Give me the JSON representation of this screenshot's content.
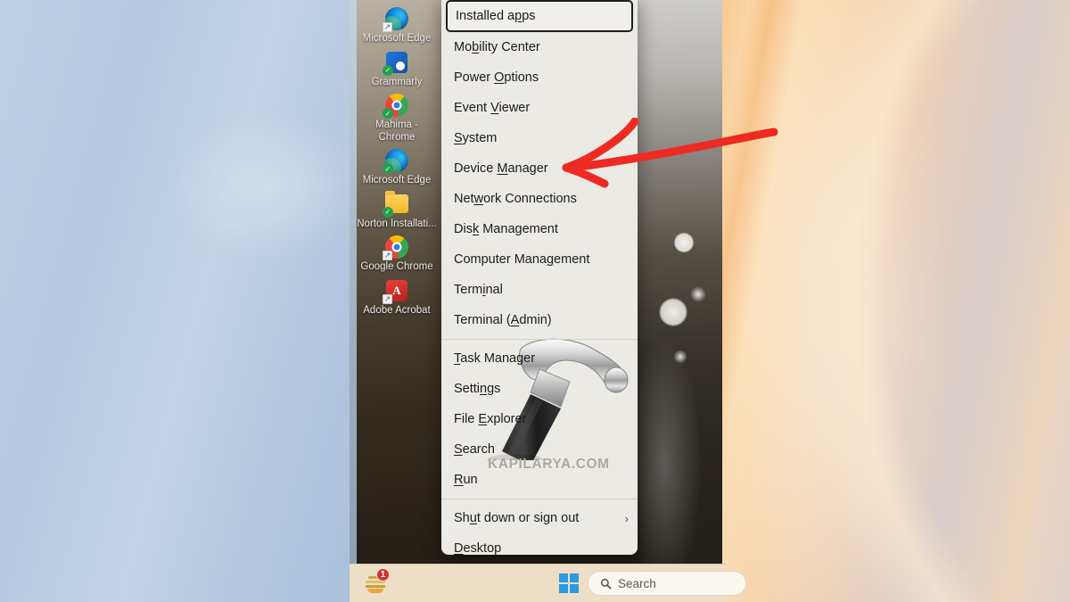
{
  "desktop": {
    "icons": [
      {
        "label": "Microsoft Edge",
        "icon": "edge-icon"
      },
      {
        "label": "Grammarly",
        "icon": "grammarly-icon"
      },
      {
        "label": "Mahima - Chrome",
        "icon": "chrome-icon"
      },
      {
        "label": "Microsoft Edge",
        "icon": "edge-icon"
      },
      {
        "label": "Norton Installati...",
        "icon": "folder-icon"
      },
      {
        "label": "Google Chrome",
        "icon": "chrome-icon"
      },
      {
        "label": "Adobe Acrobat",
        "icon": "acrobat-icon"
      }
    ]
  },
  "winx_menu": {
    "groups": [
      {
        "items": [
          {
            "pre": "Installed a",
            "key": "p",
            "post": "ps",
            "focused": true
          },
          {
            "pre": "Mo",
            "key": "b",
            "post": "ility Center",
            "focused": false
          },
          {
            "pre": "Power ",
            "key": "O",
            "post": "ptions",
            "focused": false
          },
          {
            "pre": "Event ",
            "key": "V",
            "post": "iewer",
            "focused": false
          },
          {
            "pre": "",
            "key": "S",
            "post": "ystem",
            "focused": false
          },
          {
            "pre": "Device ",
            "key": "M",
            "post": "anager",
            "focused": false
          },
          {
            "pre": "Net",
            "key": "w",
            "post": "ork Connections",
            "focused": false
          },
          {
            "pre": "Dis",
            "key": "k",
            "post": " Management",
            "focused": false
          },
          {
            "pre": "Computer Mana",
            "key": "g",
            "post": "ement",
            "focused": false
          },
          {
            "pre": "Term",
            "key": "i",
            "post": "nal",
            "focused": false
          },
          {
            "pre": "Terminal (",
            "key": "A",
            "post": "dmin)",
            "focused": false
          }
        ]
      },
      {
        "items": [
          {
            "pre": "",
            "key": "T",
            "post": "ask Manager",
            "focused": false
          },
          {
            "pre": "Setti",
            "key": "n",
            "post": "gs",
            "focused": false
          },
          {
            "pre": "File ",
            "key": "E",
            "post": "xplorer",
            "focused": false
          },
          {
            "pre": "",
            "key": "S",
            "post": "earch",
            "focused": false
          },
          {
            "pre": "",
            "key": "R",
            "post": "un",
            "focused": false
          }
        ]
      },
      {
        "items": [
          {
            "pre": "Sh",
            "key": "u",
            "post": "t down or sign out",
            "focused": false,
            "chevron": "›"
          },
          {
            "pre": "",
            "key": "D",
            "post": "esktop",
            "focused": false
          }
        ]
      }
    ],
    "watermark": "KAPILARYA.COM"
  },
  "annotation": {
    "arrow_color": "#ee2a22",
    "points_to": "Device Manager"
  },
  "taskbar": {
    "app_badge_count": "1",
    "search_placeholder": "Search"
  },
  "colors": {
    "menu_bg": "#eceae4",
    "menu_text": "#1b1b1b",
    "taskbar_bg": "#ecdfc6",
    "accent_blue": "#2b9ae3",
    "arrow_red": "#ee2a22"
  }
}
